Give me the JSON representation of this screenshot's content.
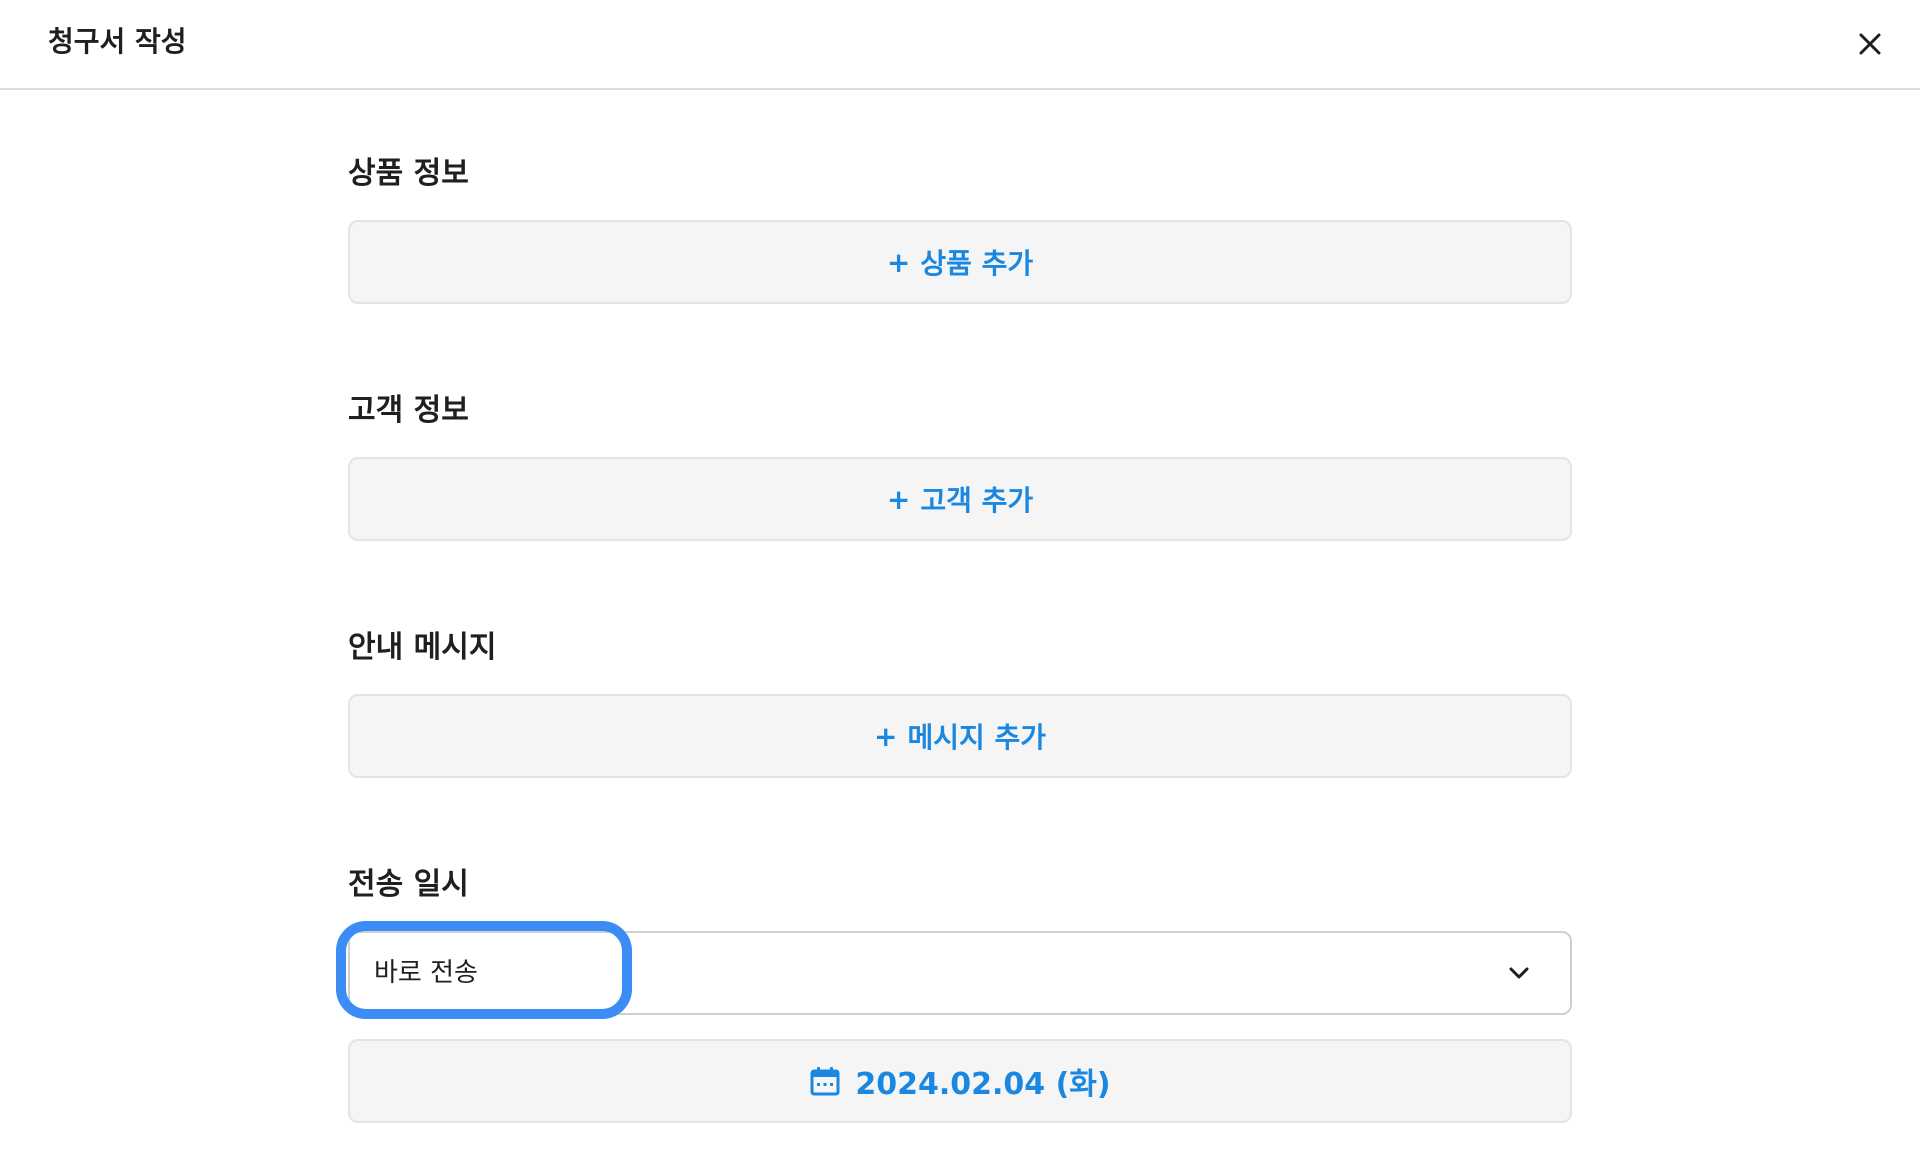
{
  "header": {
    "title": "청구서 작성",
    "close_icon": "close-icon"
  },
  "sections": {
    "product": {
      "title": "상품 정보",
      "add_plus": "+",
      "add_label": "상품 추가"
    },
    "customer": {
      "title": "고객 정보",
      "add_plus": "+",
      "add_label": "고객 추가"
    },
    "message": {
      "title": "안내 메시지",
      "add_plus": "+",
      "add_label": "메시지 추가"
    },
    "send": {
      "title": "전송 일시",
      "select_value": "바로 전송",
      "date_label": "2024.02.04 (화)",
      "date_icon": "calendar-icon"
    }
  },
  "colors": {
    "accent": "#1a88e0",
    "focus_ring": "#3b8cf5",
    "box_bg": "#f5f5f5"
  }
}
